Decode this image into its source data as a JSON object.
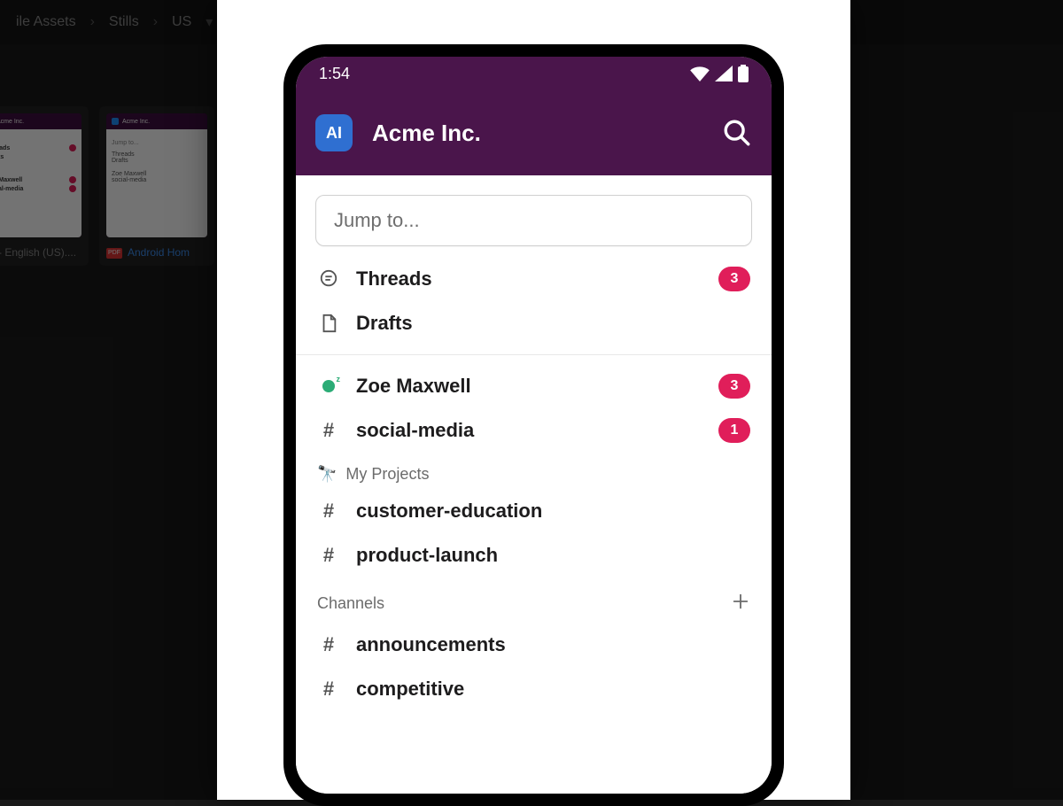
{
  "bg": {
    "breadcrumb": {
      "a": "ile Assets",
      "b": "Stills",
      "c": "US"
    },
    "card1_label": "me - English (US)....",
    "card2_label": "Android Hom",
    "thumb_workspace": "Acme Inc.",
    "thumb_rows": [
      "Threads",
      "Drafts"
    ],
    "thumb_rows2": [
      "Zoe Maxwell",
      "social-media"
    ]
  },
  "status": {
    "time": "1:54"
  },
  "workspace": {
    "badge": "AI",
    "name": "Acme Inc."
  },
  "search": {
    "placeholder": "Jump to..."
  },
  "top_items": [
    {
      "icon": "thread",
      "label": "Threads",
      "badge": "3"
    },
    {
      "icon": "draft",
      "label": "Drafts",
      "badge": null
    }
  ],
  "unread": [
    {
      "icon": "presence",
      "label": "Zoe Maxwell",
      "badge": "3"
    },
    {
      "icon": "hash",
      "label": "social-media",
      "badge": "1"
    }
  ],
  "projects_header": {
    "emoji": "🔭",
    "label": "My Projects"
  },
  "projects": [
    {
      "label": "customer-education"
    },
    {
      "label": "product-launch"
    }
  ],
  "channels_header": {
    "label": "Channels"
  },
  "channels": [
    {
      "label": "announcements"
    },
    {
      "label": "competitive"
    }
  ]
}
